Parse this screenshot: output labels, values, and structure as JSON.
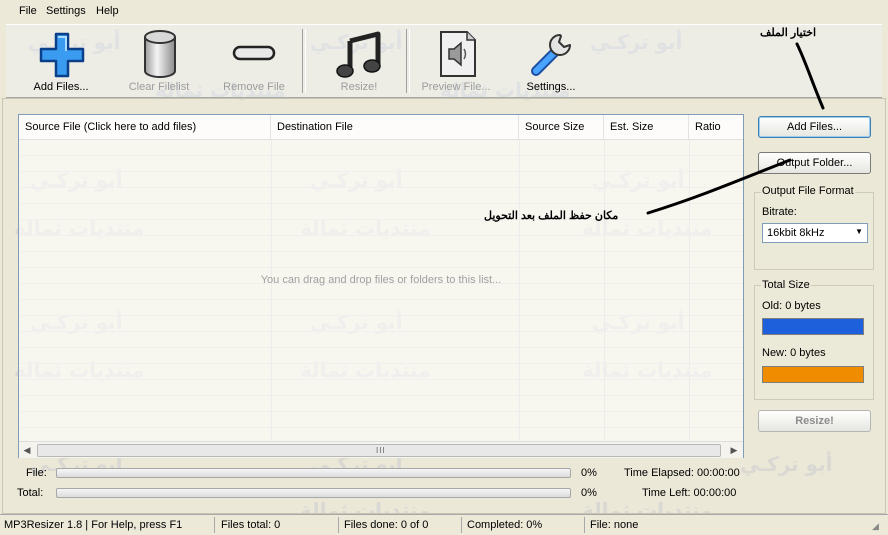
{
  "menu": {
    "items": [
      "File",
      "Settings",
      "Help"
    ]
  },
  "toolbar": {
    "add_files": "Add Files...",
    "clear_filelist": "Clear Filelist",
    "remove_file": "Remove File",
    "resize": "Resize!",
    "preview_file": "Preview File...",
    "settings": "Settings..."
  },
  "filelist": {
    "columns": [
      "Source File (Click here to add files)",
      "Destination File",
      "Source Size",
      "Est. Size",
      "Ratio"
    ],
    "empty_message": "You can drag and drop files or folders to this list..."
  },
  "right_panel": {
    "add_files_button": "Add Files...",
    "output_folder_button": "Output Folder...",
    "output_format_title": "Output File Format",
    "bitrate_label": "Bitrate:",
    "bitrate_value": "16kbit 8kHz",
    "total_size_title": "Total Size",
    "old_size": "Old: 0 bytes",
    "new_size": "New: 0 bytes",
    "old_color": "#1e5fdc",
    "new_color": "#f08c00",
    "resize_button": "Resize!"
  },
  "progress": {
    "file_label": "File:",
    "file_percent": "0%",
    "total_label": "Total:",
    "total_percent": "0%",
    "time_elapsed": "Time Elapsed: 00:00:00",
    "time_left": "Time Left: 00:00:00"
  },
  "statusbar": {
    "app": "MP3Resizer 1.8 | For Help, press F1",
    "files_total": "Files total: 0",
    "files_done": "Files done: 0 of 0",
    "completed": "Completed:  0%",
    "file": "File: none"
  },
  "annotations": {
    "choose_file": "اختيار الملف",
    "save_location": "مكان حفظ الملف بعد التحويل"
  },
  "watermark": {
    "line1": "أبو تركـي",
    "line2": "منتديات ثمالة"
  }
}
